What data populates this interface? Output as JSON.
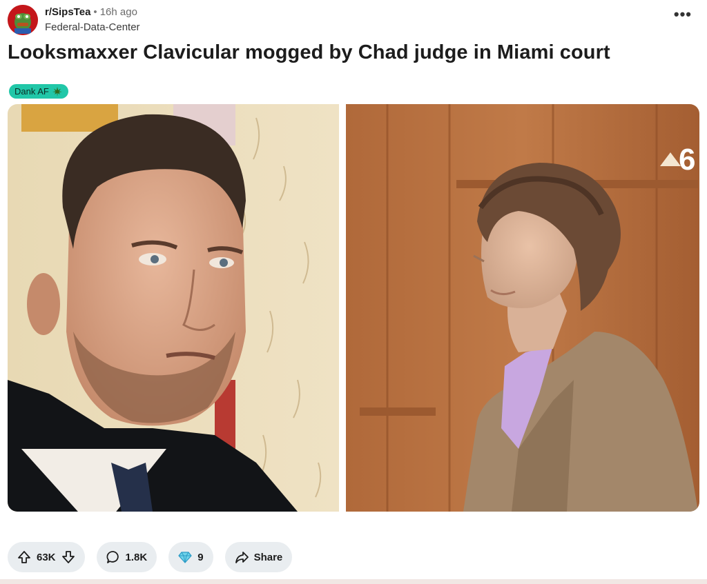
{
  "post": {
    "subreddit": "r/SipsTea",
    "separator": "•",
    "time_ago": "16h ago",
    "username": "Federal-Data-Center",
    "more_label": "•••",
    "title": "Looksmaxxer Clavicular mogged by Chad judge in Miami court",
    "flair": "Dank AF",
    "flair_icon": "cannabis-leaf-icon",
    "flair_color": "#21c7a8"
  },
  "media": {
    "left_image": "judge-portrait",
    "right_image": "defendant-in-court",
    "watermark": "6"
  },
  "actions": {
    "votes": "63K",
    "comments": "1.8K",
    "awards": "9",
    "share": "Share"
  }
}
